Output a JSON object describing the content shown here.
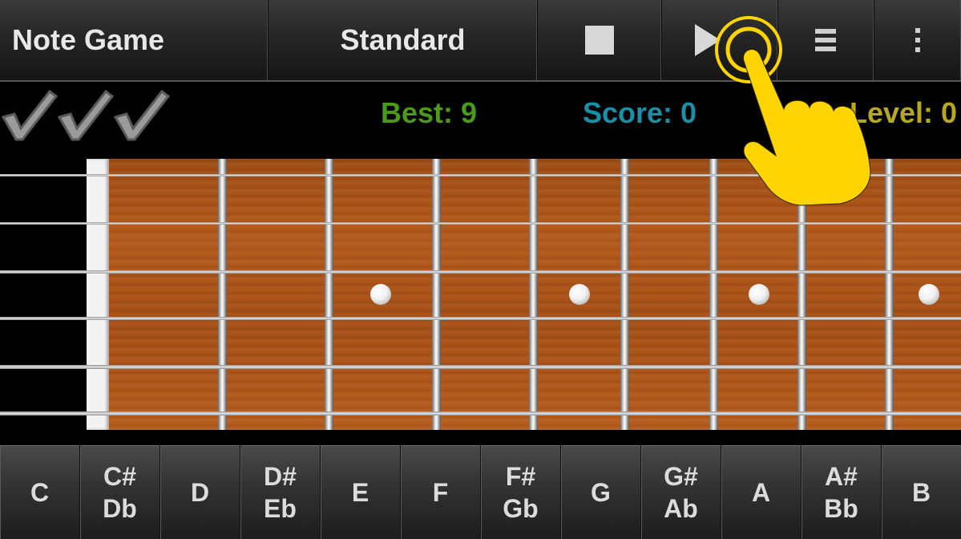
{
  "toolbar": {
    "title": "Note Game",
    "tuning": "Standard",
    "stop_icon": "stop-icon",
    "play_icon": "play-icon",
    "menu_icon": "list-menu-icon",
    "overflow_icon": "overflow-menu-icon"
  },
  "status": {
    "checks": 3,
    "best": "Best: 9",
    "score": "Score: 0",
    "level": "Level: 0",
    "colors": {
      "best": "#4a9a1c",
      "score": "#1a8fa8",
      "level": "#b7a81e"
    }
  },
  "fretboard": {
    "strings": 6,
    "inlay_frets": [
      3,
      5,
      7,
      9
    ],
    "wood_color": "#a8521a"
  },
  "notes": [
    {
      "top": "C",
      "bottom": ""
    },
    {
      "top": "C#",
      "bottom": "Db"
    },
    {
      "top": "D",
      "bottom": ""
    },
    {
      "top": "D#",
      "bottom": "Eb"
    },
    {
      "top": "E",
      "bottom": ""
    },
    {
      "top": "F",
      "bottom": ""
    },
    {
      "top": "F#",
      "bottom": "Gb"
    },
    {
      "top": "G",
      "bottom": ""
    },
    {
      "top": "G#",
      "bottom": "Ab"
    },
    {
      "top": "A",
      "bottom": ""
    },
    {
      "top": "A#",
      "bottom": "Bb"
    },
    {
      "top": "B",
      "bottom": ""
    }
  ],
  "overlay": {
    "icon": "tap-gesture-icon",
    "color": "#ffd400"
  }
}
